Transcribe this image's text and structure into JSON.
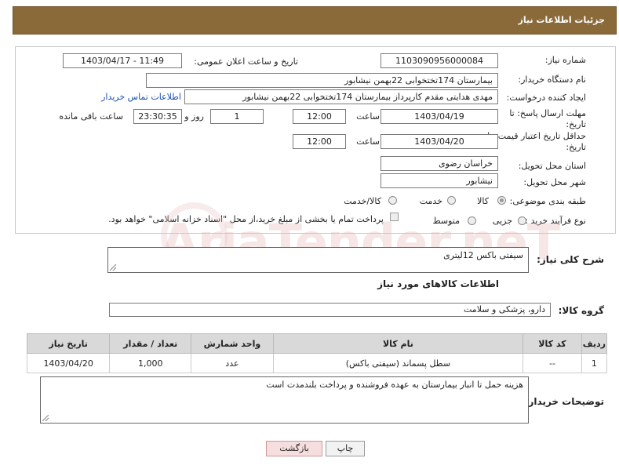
{
  "header": {
    "title": "جزئیات اطلاعات نیاز"
  },
  "fields": {
    "need_number": {
      "label": "شماره نیاز:",
      "value": "1103090956000084"
    },
    "announce_datetime": {
      "label": "تاریخ و ساعت اعلان عمومی:",
      "value": "1403/04/17 - 11:49"
    },
    "buyer_org": {
      "label": "نام دستگاه خریدار:",
      "value": "بیمارستان 174تختخوابی 22بهمن نیشابور"
    },
    "requester": {
      "label": "ایجاد کننده درخواست:",
      "value": "مهدی هدایتی مقدم کارپرداز بیمارستان 174تختخوابی 22بهمن نیشابور"
    },
    "contact_link": "اطلاعات تماس خریدار",
    "deadline": {
      "label_line1": "مهلت ارسال پاسخ: تا",
      "label_line2": "تاریخ:",
      "date": "1403/04/19",
      "time_label": "ساعت",
      "time": "12:00",
      "days": "1",
      "days_label": "روز و",
      "remaining": "23:30:35",
      "remaining_label": "ساعت باقی مانده"
    },
    "price_validity": {
      "label_line1": "حداقل تاریخ اعتبار قیمت: تا",
      "label_line2": "تاریخ:",
      "date": "1403/04/20",
      "time_label": "ساعت",
      "time": "12:00"
    },
    "province": {
      "label": "استان محل تحویل:",
      "value": "خراسان رضوی"
    },
    "city": {
      "label": "شهر محل تحویل:",
      "value": "نیشابور"
    },
    "category": {
      "label": "طبقه بندی موضوعی:",
      "options": [
        "کالا",
        "خدمت",
        "کالا/خدمت"
      ],
      "selected": "کالا"
    },
    "purchase_type": {
      "label": "نوع فرآیند خرید :",
      "options": [
        "جزیی",
        "متوسط"
      ],
      "note": "پرداخت تمام یا بخشی از مبلغ خرید،از محل \"اسناد خزانه اسلامی\" خواهد بود."
    }
  },
  "description": {
    "label": "شرح کلی نیاز:",
    "value": "سیفتی باکس 12لیتری"
  },
  "goods_section_title": "اطلاعات کالاهای مورد نیاز",
  "goods_group": {
    "label": "گروه کالا:",
    "value": "دارو، پزشکی و سلامت"
  },
  "table": {
    "headers": [
      "ردیف",
      "کد کالا",
      "نام کالا",
      "واحد شمارش",
      "تعداد / مقدار",
      "تاریخ نیاز"
    ],
    "rows": [
      [
        "1",
        "--",
        "سطل پسماند (سیفتی باکس)",
        "عدد",
        "1,000",
        "1403/04/20"
      ]
    ]
  },
  "buyer_notes": {
    "label": "توضیحات خریدار:",
    "value": "هزینه حمل تا انبار بیمارستان به عهده فروشنده و پرداخت بلندمدت است"
  },
  "buttons": {
    "print": "چاپ",
    "back": "بازگشت"
  },
  "watermark": "AriaTender.neT",
  "colors": {
    "header_bg": "#8b6a3a",
    "link": "#1a50b0",
    "table_header_bg": "#d9d9d9",
    "back_button_bg": "#f7dede"
  }
}
